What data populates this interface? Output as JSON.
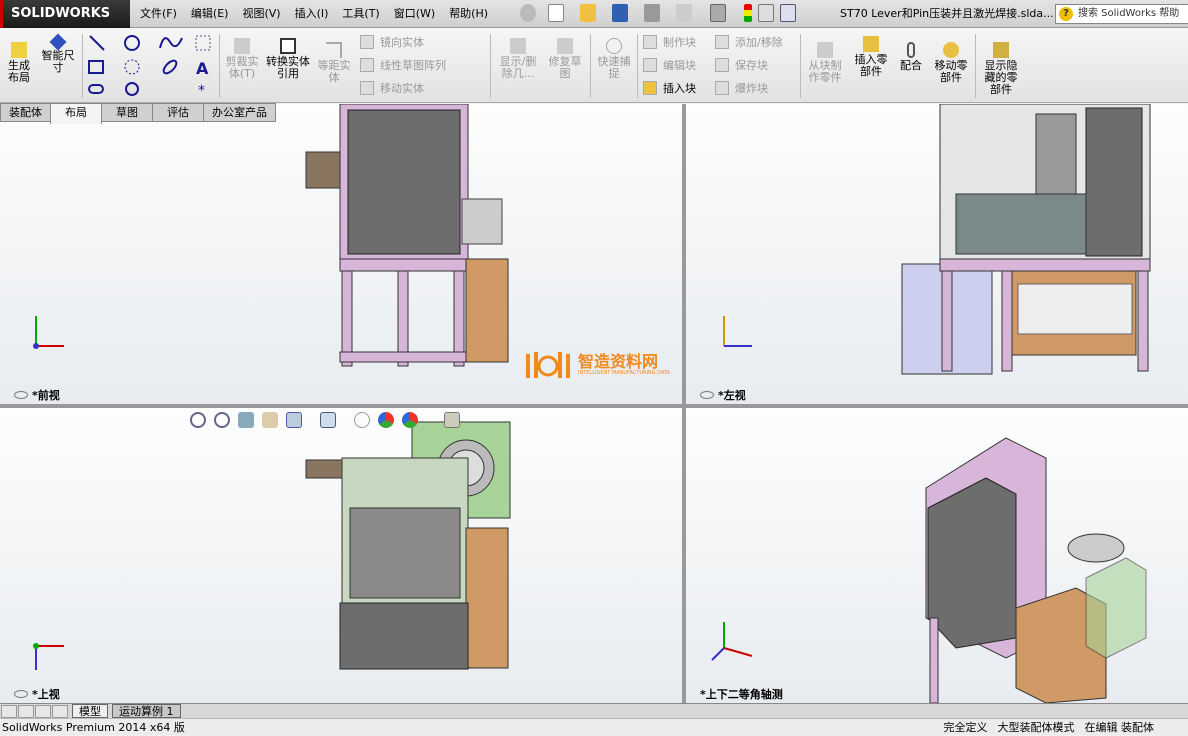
{
  "app": {
    "logo": "SOLIDWORKS",
    "document_title": "ST70 Lever和Pin压装并且激光焊接.slda...",
    "search_placeholder": "搜索 SolidWorks 帮助"
  },
  "menu": [
    "文件(F)",
    "编辑(E)",
    "视图(V)",
    "插入(I)",
    "工具(T)",
    "窗口(W)",
    "帮助(H)"
  ],
  "toolbar": {
    "generate_layout": "生成布局",
    "smart_dim": "智能尺寸",
    "trim": "剪裁实体(T)",
    "convert": "转换实体引用",
    "offset": "等距实体",
    "mirror": "镜向实体",
    "linear_pattern": "线性草图阵列",
    "move": "移动实体",
    "show_delete": "显示/删除几...",
    "repair": "修复草图",
    "quick_snap": "快速捕捉",
    "make_block": "制作块",
    "edit_block": "编辑块",
    "insert_block": "插入块",
    "add_remove": "添加/移除",
    "save_block": "保存块",
    "explode_block": "爆炸块",
    "part_from_block": "从块制作零件",
    "insert_component": "插入零部件",
    "mate": "配合",
    "move_component": "移动零部件",
    "show_hidden": "显示隐藏的零部件"
  },
  "tabs": [
    {
      "label": "装配体",
      "active": false
    },
    {
      "label": "布局",
      "active": true
    },
    {
      "label": "草图",
      "active": false
    },
    {
      "label": "评估",
      "active": false
    },
    {
      "label": "办公室产品",
      "active": false
    }
  ],
  "viewports": {
    "front": "*前视",
    "left": "*左视",
    "top": "*上视",
    "iso": "*上下二等角轴测"
  },
  "watermark": {
    "name": "智造资料网",
    "sub": "INTELLIGENT MANUFACTURING DATA"
  },
  "sheet_tabs": [
    "模型",
    "运动算例 1"
  ],
  "status": {
    "version": "SolidWorks Premium 2014 x64 版",
    "items": [
      "完全定义",
      "大型装配体模式",
      "在编辑 装配体"
    ]
  },
  "colors": {
    "frame": "#d7b6da",
    "panel": "#6d6d6d",
    "wood": "#d09a66",
    "feeder": "#a8d49a"
  }
}
